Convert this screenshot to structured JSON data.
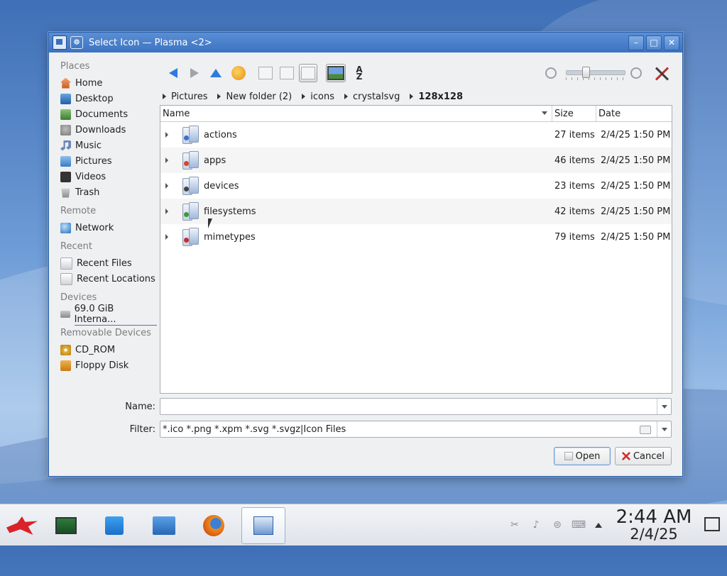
{
  "window": {
    "title": "Select Icon — Plasma <2>"
  },
  "sidebar": {
    "sections": [
      {
        "title": "Places",
        "items": [
          {
            "label": "Home",
            "icon": "home-icon"
          },
          {
            "label": "Desktop",
            "icon": "desktop-icon"
          },
          {
            "label": "Documents",
            "icon": "documents-icon"
          },
          {
            "label": "Downloads",
            "icon": "downloads-icon"
          },
          {
            "label": "Music",
            "icon": "music-icon"
          },
          {
            "label": "Pictures",
            "icon": "pictures-icon"
          },
          {
            "label": "Videos",
            "icon": "videos-icon"
          },
          {
            "label": "Trash",
            "icon": "trash-icon"
          }
        ]
      },
      {
        "title": "Remote",
        "items": [
          {
            "label": "Network",
            "icon": "network-icon"
          }
        ]
      },
      {
        "title": "Recent",
        "items": [
          {
            "label": "Recent Files",
            "icon": "recent-files-icon"
          },
          {
            "label": "Recent Locations",
            "icon": "recent-locations-icon"
          }
        ]
      },
      {
        "title": "Devices",
        "items": [
          {
            "label": "69.0 GiB Interna...",
            "icon": "hard-drive-icon"
          }
        ]
      },
      {
        "title": "Removable Devices",
        "items": [
          {
            "label": "CD_ROM",
            "icon": "cdrom-icon"
          },
          {
            "label": "Floppy Disk",
            "icon": "floppy-icon"
          }
        ]
      }
    ]
  },
  "toolbar": {
    "zoom_level": 0.3
  },
  "breadcrumb": [
    "Pictures",
    "New folder (2)",
    "icons",
    "crystalsvg",
    "128x128"
  ],
  "filelist": {
    "columns": {
      "name": "Name",
      "size": "Size",
      "date": "Date"
    },
    "rows": [
      {
        "name": "actions",
        "size": "27 items",
        "date": "2/4/25 1:50 PM",
        "accent": "#3b6fd0"
      },
      {
        "name": "apps",
        "size": "46 items",
        "date": "2/4/25 1:50 PM",
        "accent": "#d6452a"
      },
      {
        "name": "devices",
        "size": "23 items",
        "date": "2/4/25 1:50 PM",
        "accent": "#444444"
      },
      {
        "name": "filesystems",
        "size": "42 items",
        "date": "2/4/25 1:50 PM",
        "accent": "#3a9a3a"
      },
      {
        "name": "mimetypes",
        "size": "79 items",
        "date": "2/4/25 1:50 PM",
        "accent": "#c23030"
      }
    ]
  },
  "form": {
    "name_label": "Name:",
    "name_value": "",
    "filter_label": "Filter:",
    "filter_value": "*.ico *.png *.xpm *.svg *.svgz|Icon Files"
  },
  "buttons": {
    "open": "Open",
    "cancel": "Cancel"
  },
  "taskbar": {
    "time": "2:44 AM",
    "date": "2/4/25"
  },
  "colors": {
    "titlebar": "#3c72c0",
    "accent": "#2e7be0"
  }
}
